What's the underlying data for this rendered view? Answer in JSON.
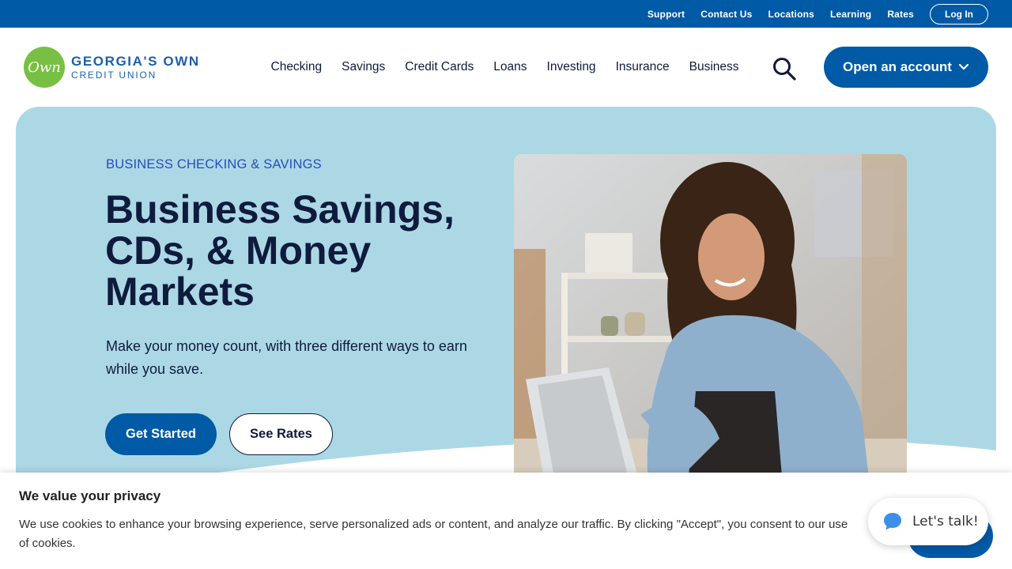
{
  "utility_nav": {
    "links": [
      "Support",
      "Contact Us",
      "Locations",
      "Learning",
      "Rates"
    ],
    "login_label": "Log In"
  },
  "brand": {
    "logo_mark": "Own",
    "name_line1": "GEORGIA'S OWN",
    "name_line2": "CREDIT UNION",
    "primary_color": "#005aa6",
    "logo_color": "#78c043"
  },
  "main_nav": {
    "items": [
      "Checking",
      "Savings",
      "Credit Cards",
      "Loans",
      "Investing",
      "Insurance",
      "Business"
    ],
    "search_icon": "search-icon",
    "open_account_label": "Open an account"
  },
  "hero": {
    "eyebrow": "BUSINESS CHECKING & SAVINGS",
    "title": "Business Savings, CDs, & Money Markets",
    "subtitle": "Make your money count, with three different ways to earn while you save.",
    "primary_cta": "Get Started",
    "secondary_cta": "See Rates",
    "background_color": "#acd8e6"
  },
  "cookie_banner": {
    "title": "We value your privacy",
    "text": "We use cookies to enhance your browsing experience, serve personalized ads or content, and analyze our traffic. By clicking \"Accept\", you consent to our use of cookies."
  },
  "chat": {
    "label": "Let's talk!",
    "icon": "chat-bubble-icon"
  }
}
